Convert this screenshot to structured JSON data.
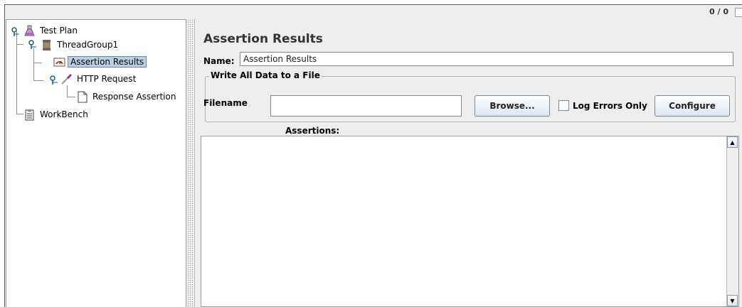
{
  "topbar": {
    "counter": "0 / 0"
  },
  "tree": {
    "items": [
      {
        "label": "Test Plan",
        "icon": "flask-icon"
      },
      {
        "label": "ThreadGroup1",
        "icon": "spool-icon"
      },
      {
        "label": "Assertion Results",
        "icon": "gauge-icon",
        "selected": true
      },
      {
        "label": "HTTP Request",
        "icon": "pipette-icon"
      },
      {
        "label": "Response Assertion",
        "icon": "document-icon"
      },
      {
        "label": "WorkBench",
        "icon": "clipboard-icon"
      }
    ]
  },
  "panel": {
    "title": "Assertion Results",
    "name_label": "Name:",
    "name_value": "Assertion Results",
    "file_group": {
      "title": "Write All Data to a File",
      "filename_label": "Filename",
      "filename_value": "",
      "browse_label": "Browse...",
      "log_errors_label": "Log Errors Only",
      "log_errors_checked": false,
      "configure_label": "Configure"
    },
    "assertions_label": "Assertions:"
  },
  "colors": {
    "background": "#eeeeee",
    "selection": "#b8cfe5",
    "selection_border": "#6382bf"
  }
}
